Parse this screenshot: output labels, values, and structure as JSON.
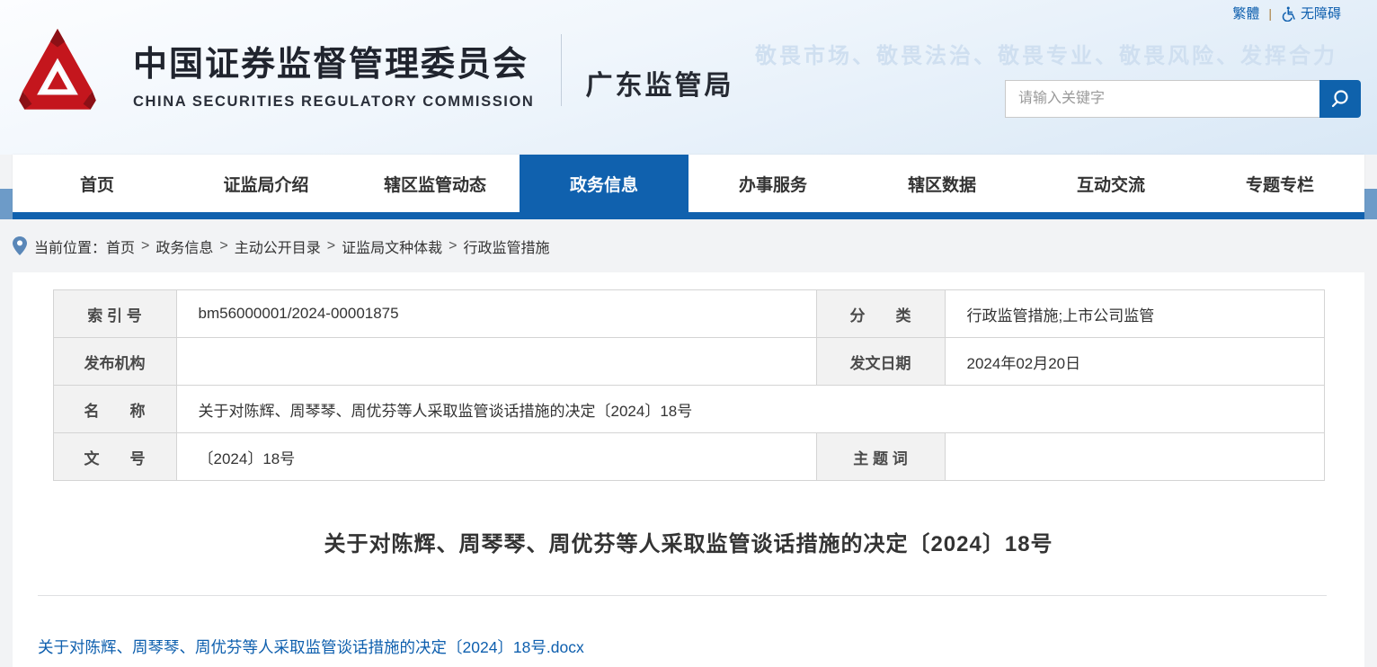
{
  "topbar": {
    "traditional_label": "繁體",
    "separator": "|",
    "accessibility_label": "无障碍"
  },
  "header": {
    "org_cn": "中国证券监督管理委员会",
    "org_en": "CHINA SECURITIES REGULATORY COMMISSION",
    "bureau": "广东监管局",
    "slogan": "敬畏市场、敬畏法治、敬畏专业、敬畏风险、发挥合力",
    "search": {
      "placeholder": "请输入关键字"
    }
  },
  "nav": {
    "items": [
      {
        "label": "首页"
      },
      {
        "label": "证监局介绍"
      },
      {
        "label": "辖区监管动态"
      },
      {
        "label": "政务信息",
        "active": true
      },
      {
        "label": "办事服务"
      },
      {
        "label": "辖区数据"
      },
      {
        "label": "互动交流"
      },
      {
        "label": "专题专栏"
      }
    ]
  },
  "breadcrumb": {
    "prefix": "当前位置：",
    "separator": ">",
    "items": [
      "首页",
      "政务信息",
      "主动公开目录",
      "证监局文种体裁",
      "行政监管措施"
    ]
  },
  "doc_table": {
    "index_label": "索 引 号",
    "index_value": "bm56000001/2024-00001875",
    "category_label": "分　　类",
    "category_value": "行政监管措施;上市公司监管",
    "issuer_label": "发布机构",
    "issuer_value": "",
    "date_label": "发文日期",
    "date_value": "2024年02月20日",
    "name_label": "名　　称",
    "name_value": "关于对陈辉、周琴琴、周优芬等人采取监管谈话措施的决定〔2024〕18号",
    "docnum_label": "文　　号",
    "docnum_value": "〔2024〕18号",
    "subject_label": "主 题 词",
    "subject_value": ""
  },
  "article": {
    "title": "关于对陈辉、周琴琴、周优芬等人采取监管谈话措施的决定〔2024〕18号",
    "attachment_link": "关于对陈辉、周琴琴、周优芬等人采取监管谈话措施的决定〔2024〕18号.docx"
  },
  "colors": {
    "accent_blue": "#1061ae",
    "band_blue": "#6d9bc8",
    "logo_red": "#c4161d",
    "slogan_blue": "#cfdff0",
    "link_blue": "#0e5fae"
  }
}
